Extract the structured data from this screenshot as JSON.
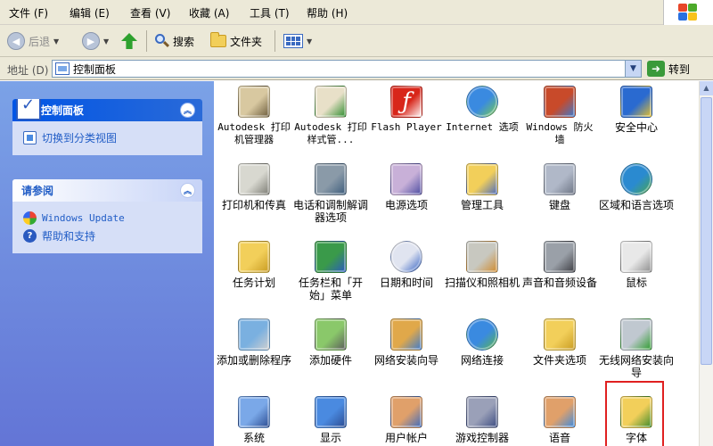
{
  "menubar": {
    "items": [
      "文件 (F)",
      "编辑 (E)",
      "查看 (V)",
      "收藏 (A)",
      "工具 (T)",
      "帮助 (H)"
    ]
  },
  "toolbar": {
    "back_label": "后退",
    "search_label": "搜索",
    "folders_label": "文件夹"
  },
  "address": {
    "label": "地址 (D)",
    "value": "控制面板",
    "go_label": "转到"
  },
  "sidebar": {
    "control_panel": {
      "title": "控制面板",
      "tasks": [
        "切换到分类视图"
      ]
    },
    "see_also": {
      "title": "请参阅",
      "tasks": [
        "Windows Update",
        "帮助和支持"
      ]
    }
  },
  "items": [
    {
      "label": "Autodesk 打印机管理器",
      "icon": "printer-manager-icon"
    },
    {
      "label": "Autodesk 打印样式管...",
      "icon": "plot-style-icon"
    },
    {
      "label": "Flash Player",
      "icon": "flash-icon"
    },
    {
      "label": "Internet 选项",
      "icon": "internet-options-icon"
    },
    {
      "label": "Windows 防火墙",
      "icon": "firewall-icon"
    },
    {
      "label": "安全中心",
      "icon": "security-center-icon"
    },
    {
      "label": "打印机和传真",
      "icon": "printer-icon"
    },
    {
      "label": "电话和调制解调器选项",
      "icon": "phone-modem-icon"
    },
    {
      "label": "电源选项",
      "icon": "power-icon"
    },
    {
      "label": "管理工具",
      "icon": "admin-tools-icon"
    },
    {
      "label": "键盘",
      "icon": "keyboard-icon"
    },
    {
      "label": "区域和语言选项",
      "icon": "globe-icon"
    },
    {
      "label": "任务计划",
      "icon": "scheduled-tasks-icon"
    },
    {
      "label": "任务栏和「开始」菜单",
      "icon": "taskbar-icon"
    },
    {
      "label": "日期和时间",
      "icon": "clock-icon"
    },
    {
      "label": "扫描仪和照相机",
      "icon": "scanner-icon"
    },
    {
      "label": "声音和音频设备",
      "icon": "speaker-icon"
    },
    {
      "label": "鼠标",
      "icon": "mouse-icon"
    },
    {
      "label": "添加或删除程序",
      "icon": "add-remove-icon"
    },
    {
      "label": "添加硬件",
      "icon": "add-hardware-icon"
    },
    {
      "label": "网络安装向导",
      "icon": "network-setup-icon"
    },
    {
      "label": "网络连接",
      "icon": "network-connections-icon"
    },
    {
      "label": "文件夹选项",
      "icon": "folder-options-icon"
    },
    {
      "label": "无线网络安装向导",
      "icon": "wireless-icon"
    },
    {
      "label": "系统",
      "icon": "system-icon"
    },
    {
      "label": "显示",
      "icon": "display-icon"
    },
    {
      "label": "用户帐户",
      "icon": "user-accounts-icon"
    },
    {
      "label": "游戏控制器",
      "icon": "game-controller-icon"
    },
    {
      "label": "语音",
      "icon": "speech-icon"
    },
    {
      "label": "字体",
      "icon": "fonts-icon"
    }
  ]
}
